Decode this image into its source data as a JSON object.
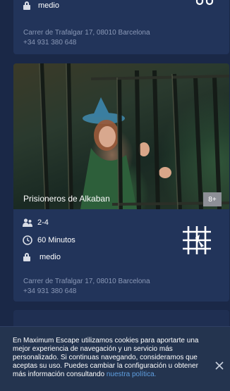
{
  "top_card": {
    "difficulty": "medio",
    "address": "Carrer de Trafalgar 17, 08010 Barcelona",
    "phone": "+34 931 380 648"
  },
  "room_card": {
    "title": "Prisioneros de Alkaban",
    "min_age_badge": "8+",
    "players": "2-4",
    "duration": "60 Minutos",
    "difficulty": "medio",
    "address": "Carrer de Trafalgar 17, 08010 Barcelona",
    "phone": "+34 931 380 648"
  },
  "cookie_banner": {
    "text": "En Maximum Escape utilizamos cookies para aportarte una mejor experiencia de navegación y un servicio más personalizado. Si continuas navegando, consideramos que aceptas su uso. Puedes cambiar la configuración u obtener más información consultando ",
    "link_label": "nuestra política.",
    "close_symbol": "✕"
  },
  "colors": {
    "background": "#1a2847",
    "card": "#22345a",
    "muted_text": "#8a98b6",
    "link": "#5f9fe0",
    "badge": "#8d8f96"
  },
  "icons": {
    "lock": "lock-icon",
    "players": "people-icon",
    "clock": "clock-icon",
    "room_type": "grid-cage-icon",
    "close": "close-icon"
  }
}
